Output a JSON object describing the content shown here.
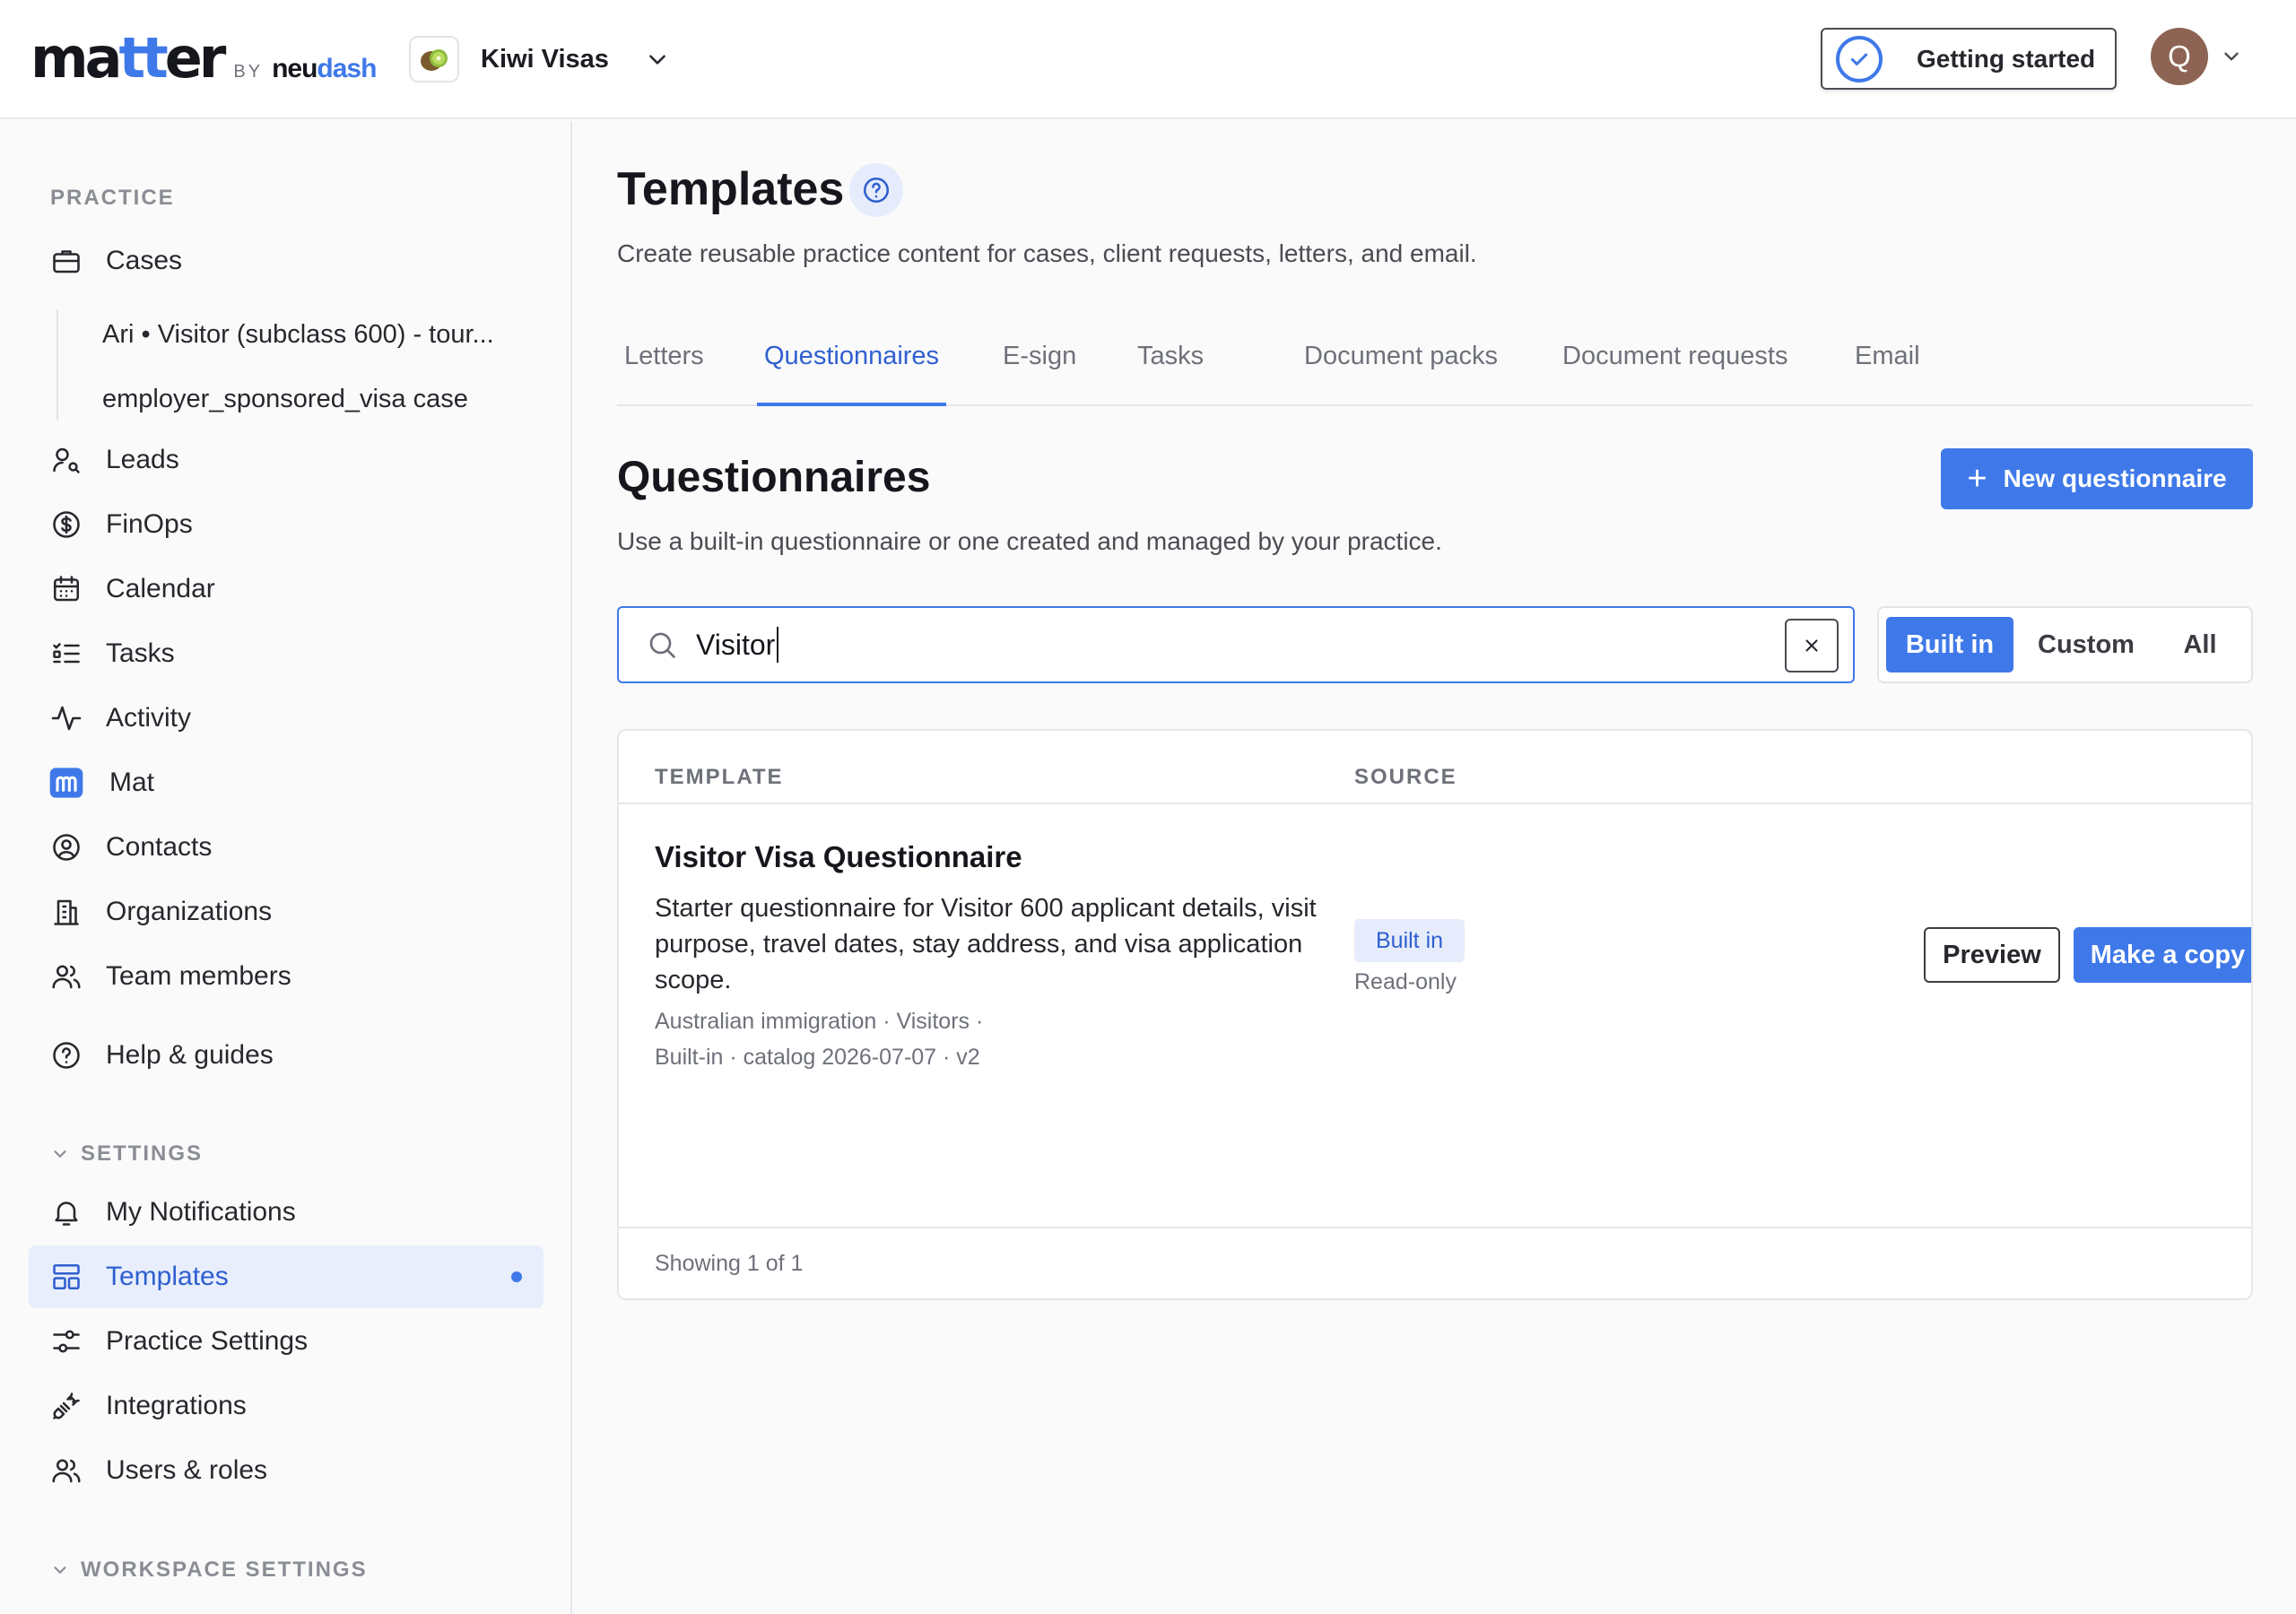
{
  "brand": {
    "logo_main": "matter",
    "logo_by": "BY",
    "logo_neu": "neu",
    "logo_dash": "dash"
  },
  "workspace": {
    "name": "Kiwi Visas",
    "icon": "kiwi-fruit-icon"
  },
  "header": {
    "getting_started": "Getting started",
    "avatar_initial": "Q"
  },
  "sidebar": {
    "practice_label": "PRACTICE",
    "cases": "Cases",
    "recent_cases": [
      "Ari • Visitor (subclass 600) - tour...",
      "employer_sponsored_visa case"
    ],
    "practice_items": [
      {
        "label": "Leads",
        "icon": "user-search-icon"
      },
      {
        "label": "FinOps",
        "icon": "dollar-circle-icon"
      },
      {
        "label": "Calendar",
        "icon": "calendar-icon"
      },
      {
        "label": "Tasks",
        "icon": "task-list-icon"
      },
      {
        "label": "Activity",
        "icon": "activity-icon"
      },
      {
        "label": "Mat",
        "icon": "mat-logo-icon"
      },
      {
        "label": "Contacts",
        "icon": "contact-circle-icon"
      },
      {
        "label": "Organizations",
        "icon": "building-icon"
      },
      {
        "label": "Team members",
        "icon": "team-icon"
      }
    ],
    "help": "Help & guides",
    "settings_label": "SETTINGS",
    "settings_items": [
      {
        "label": "My Notifications",
        "icon": "bell-icon"
      },
      {
        "label": "Templates",
        "icon": "template-icon"
      },
      {
        "label": "Practice Settings",
        "icon": "sliders-icon"
      },
      {
        "label": "Integrations",
        "icon": "plug-icon"
      },
      {
        "label": "Users & roles",
        "icon": "users-icon"
      }
    ],
    "workspace_settings_label": "WORKSPACE SETTINGS"
  },
  "main": {
    "title": "Templates",
    "subtitle": "Create reusable practice content for cases, client requests, letters, and email.",
    "tabs": [
      "Letters",
      "Questionnaires",
      "E-sign",
      "Tasks",
      "Document packs",
      "Document requests",
      "Email"
    ],
    "active_tab": "Questionnaires",
    "section_title": "Questionnaires",
    "section_subtitle": "Use a built-in questionnaire or one created and managed by your practice.",
    "new_button": "New questionnaire",
    "search_value": "Visitor",
    "filters": [
      "Built in",
      "Custom",
      "All"
    ],
    "active_filter": "Built in",
    "table": {
      "col_template": "TEMPLATE",
      "col_source": "SOURCE",
      "row": {
        "title": "Visitor Visa Questionnaire",
        "description": "Starter questionnaire for Visitor 600 applicant details, visit purpose, travel dates, stay address, and visa application scope.",
        "meta_line1": "Australian immigration · Visitors ·",
        "meta_line2": "Built-in · catalog 2026-07-07 · v2",
        "source_badge": "Built in",
        "source_note": "Read-only",
        "preview": "Preview",
        "copy": "Make a copy"
      },
      "footer": "Showing 1 of 1"
    }
  },
  "colors": {
    "accent": "#3f79e9",
    "accent_soft": "#e6ecfb",
    "text": "#1c1d22",
    "muted": "#6e7179"
  }
}
